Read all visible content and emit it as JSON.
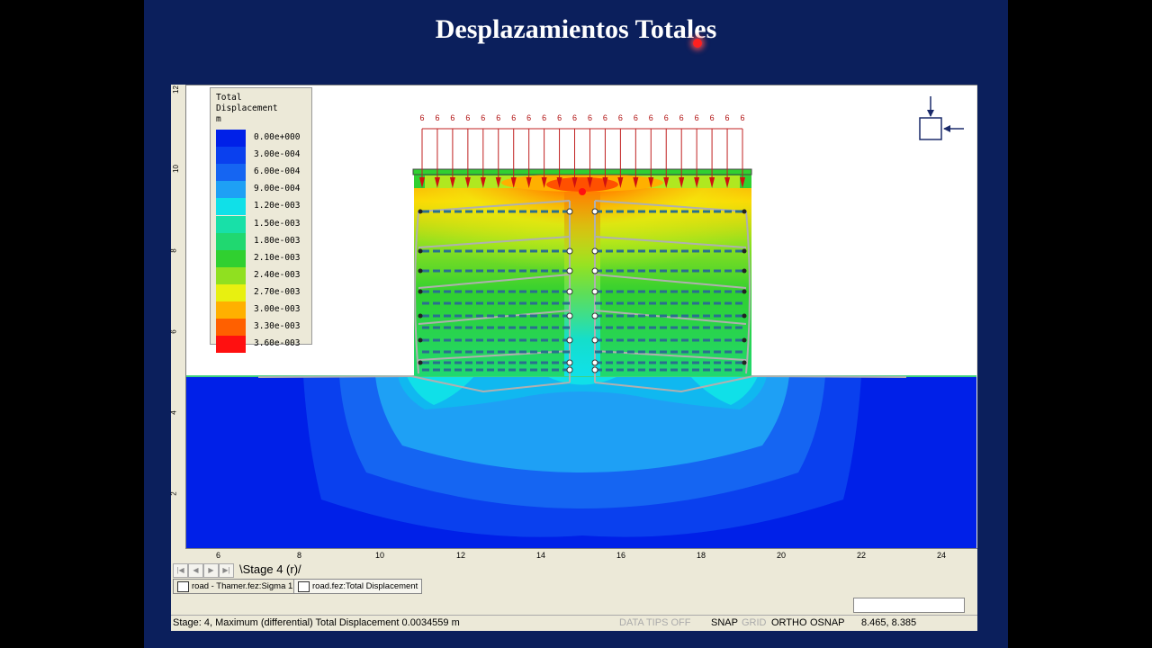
{
  "slide": {
    "title": "Desplazamientos Totales"
  },
  "legend": {
    "title_line1": "Total",
    "title_line2": "Displacement",
    "unit": "m",
    "items": [
      {
        "label": "0.00e+000",
        "color": "#0020e8"
      },
      {
        "label": "3.00e-004",
        "color": "#0a40ee"
      },
      {
        "label": "6.00e-004",
        "color": "#1565f2"
      },
      {
        "label": "9.00e-004",
        "color": "#1ea0f5"
      },
      {
        "label": "1.20e-003",
        "color": "#10e0e8"
      },
      {
        "label": "1.50e-003",
        "color": "#18e0a8"
      },
      {
        "label": "1.80e-003",
        "color": "#20d870"
      },
      {
        "label": "2.10e-003",
        "color": "#30d030"
      },
      {
        "label": "2.40e-003",
        "color": "#90e020"
      },
      {
        "label": "2.70e-003",
        "color": "#e8f010"
      },
      {
        "label": "3.00e-003",
        "color": "#ffb000"
      },
      {
        "label": "3.30e-003",
        "color": "#ff6000"
      },
      {
        "label": "3.60e-003",
        "color": "#ff1010"
      }
    ]
  },
  "load_value": "6",
  "axes": {
    "x_ticks": [
      "6",
      "8",
      "10",
      "12",
      "14",
      "16",
      "18",
      "20",
      "22",
      "24"
    ],
    "y_ticks": [
      "2",
      "4",
      "6",
      "8",
      "10",
      "12"
    ]
  },
  "stage_tab": "Stage 4 (r)",
  "doc_tabs": [
    "road - Thamer.fez:Sigma 1",
    "road.fez:Total Displacement"
  ],
  "status": {
    "message": "Stage: 4, Maximum (differential) Total Displacement 0.0034559 m",
    "data_tips": "DATA TIPS OFF",
    "snap": "SNAP",
    "grid": "GRID",
    "ortho": "ORTHO",
    "osnap": "OSNAP",
    "coords": "8.465,  8.385"
  }
}
